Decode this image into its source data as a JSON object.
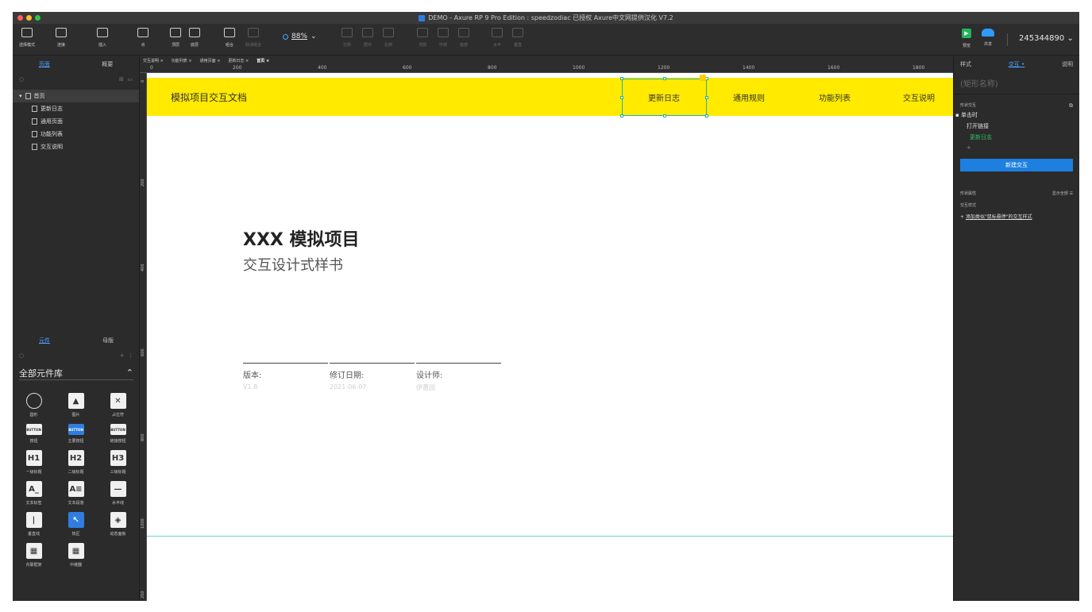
{
  "window": {
    "title": "DEMO - Axure RP 9 Pro Edition : speedzodiac 已授权    Axure中文网提供汉化 V7.2",
    "traffic_colors": [
      "#ff5f57",
      "#febc2e",
      "#28c840"
    ]
  },
  "toolbar": {
    "items": [
      {
        "label": "选择模式",
        "icon": "select-mode-icon"
      },
      {
        "label": "连接",
        "icon": "connect-icon"
      },
      {
        "label": "插入",
        "icon": "insert-icon"
      },
      {
        "label": "点",
        "icon": "point-icon"
      },
      {
        "label": "顶层",
        "icon": "bring-front-icon"
      },
      {
        "label": "底层",
        "icon": "send-back-icon"
      },
      {
        "label": "组合",
        "icon": "group-icon"
      },
      {
        "label": "取消组合",
        "icon": "ungroup-icon"
      }
    ],
    "align_items": [
      "左侧",
      "居中",
      "右侧",
      "顶部",
      "中部",
      "底部",
      "水平",
      "垂直"
    ],
    "zoom": "88%",
    "preview_label": "预览",
    "share_label": "共享",
    "user": "245344890"
  },
  "left_panel": {
    "tabs": [
      "页面",
      "概要"
    ],
    "pages": [
      "首页",
      "更新日志",
      "通用页面",
      "功能列表",
      "交互说明"
    ],
    "lib_tabs": [
      "元件",
      "母版"
    ],
    "library": "全部元件库",
    "widgets": [
      {
        "label": "圆形",
        "glyph": ""
      },
      {
        "label": "图片",
        "glyph": "▲"
      },
      {
        "label": "占位符",
        "glyph": "✕"
      },
      {
        "label": "按钮",
        "glyph": "BUTTON"
      },
      {
        "label": "主要按钮",
        "glyph": "BUTTON"
      },
      {
        "label": "链接按钮",
        "glyph": "BUTTON"
      },
      {
        "label": "一级标题",
        "glyph": "H1"
      },
      {
        "label": "二级标题",
        "glyph": "H2"
      },
      {
        "label": "三级标题",
        "glyph": "H3"
      },
      {
        "label": "文本标签",
        "glyph": "A_"
      },
      {
        "label": "文本段落",
        "glyph": "A≡"
      },
      {
        "label": "水平线",
        "glyph": "—"
      },
      {
        "label": "垂直线",
        "glyph": "|"
      },
      {
        "label": "热区",
        "glyph": "↖"
      },
      {
        "label": "动态面板",
        "glyph": "◈"
      },
      {
        "label": "内联框架",
        "glyph": "▦"
      },
      {
        "label": "中继器",
        "glyph": "▦"
      }
    ]
  },
  "doc_tabs": [
    "交互说明",
    "功能列表",
    "通用页面",
    "更新日志",
    "首页"
  ],
  "ruler": {
    "h": [
      "0",
      "200",
      "400",
      "600",
      "800",
      "1000",
      "1200",
      "1400",
      "1600",
      "1800"
    ],
    "v": [
      "0",
      "200",
      "400",
      "600",
      "800",
      "1000",
      "200"
    ]
  },
  "canvas": {
    "header_title": "模拟项目交互文档",
    "nav": [
      "更新日志",
      "通用规则",
      "功能列表",
      "交互说明"
    ],
    "hero_title": "XXX 模拟项目",
    "hero_subtitle": "交互设计式样书",
    "meta": [
      {
        "label": "版本:",
        "value": "V1.8"
      },
      {
        "label": "修订日期:",
        "value": "2021-06-07"
      },
      {
        "label": "设计师:",
        "value": "伊蕙园"
      }
    ],
    "header_color": "#ffea00"
  },
  "right_panel": {
    "tabs": [
      "样式",
      "交互 •",
      "说明"
    ],
    "shape_name_placeholder": "(矩形名称)",
    "section_interaction": "形状交互",
    "event": "单击时",
    "action": "打开链接",
    "target": "更新日志",
    "new_button": "新建交互",
    "section_props": "形状属性",
    "show_all": "显示全部",
    "style_label": "交互样式",
    "add_style": "添加类似\"鼠标悬停\"的交互样式"
  }
}
